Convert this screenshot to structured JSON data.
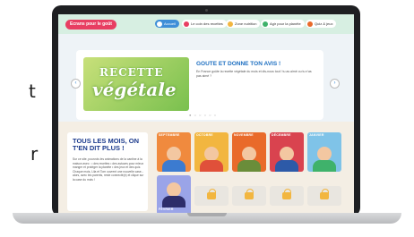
{
  "header": {
    "logo": "Ecrans pour le goût",
    "nav": [
      {
        "label": "Accueil",
        "color": "#3f8fd8"
      },
      {
        "label": "Le coin des recettes",
        "color": "#e83e62"
      },
      {
        "label": "Zone nutrition",
        "color": "#f2b640"
      },
      {
        "label": "Agir pour la planète",
        "color": "#3fb26b"
      },
      {
        "label": "Quiz & jeux",
        "color": "#e96a2a"
      }
    ]
  },
  "hero": {
    "image_line1": "RECETTE",
    "image_line2": "végétale",
    "title": "GOUTE ET DONNE TON AVIS !",
    "text": "En France goûte la recette végétale du mois et dis-nous tout ! tu as aimé ou tu n'as pas aimé ?",
    "prev": "‹",
    "next": "›",
    "dots": "● ○ ○ ○ ○ ○"
  },
  "months_section": {
    "title": "TOUS LES MOIS, ON T'EN DIT PLUS !",
    "body": "Sur ce site, pourvois les animations de la cantine à la maison avec : • des recettes • des astuces pour mieux manger et protéger la planète • des jeux et des quiz. Chaque mois, Lila et Tom ouvrent une nouvelle case... alors, avec tes parents, reste connecté(e) et clique sur la case du mois !",
    "months": [
      {
        "label": "SEPTEMBRE",
        "bg": "#f08a3e",
        "shirt": "#3c7bd0"
      },
      {
        "label": "OCTOBRE",
        "bg": "#f2b640",
        "shirt": "#e0503a"
      },
      {
        "label": "NOVEMBRE",
        "bg": "#e96a2a",
        "shirt": "#6a8d3a"
      },
      {
        "label": "DÉCEMBRE",
        "bg": "#d9434f",
        "shirt": "#2d5aa8"
      },
      {
        "label": "JANVIER",
        "bg": "#7fc3e8",
        "shirt": "#3fb26b"
      },
      {
        "label": "FÉVRIER",
        "bg": "#9aa4e8",
        "shirt": "#2d2d6a"
      }
    ]
  },
  "background_text": {
    "left1": "t",
    "left2": "r"
  }
}
